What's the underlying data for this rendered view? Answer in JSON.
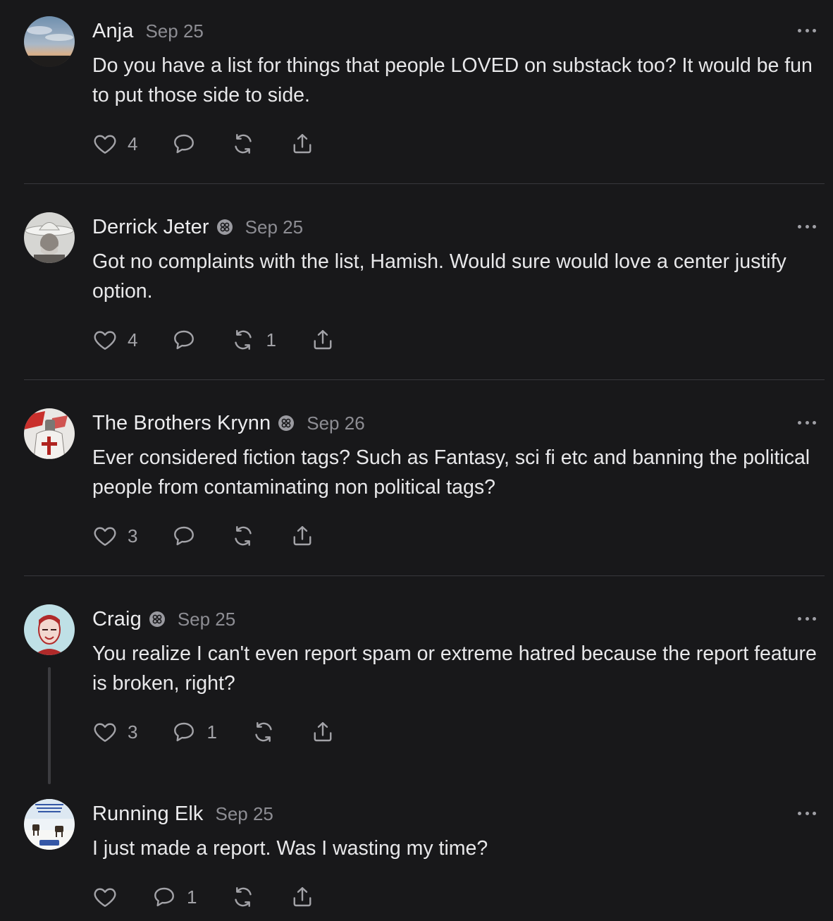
{
  "comments": [
    {
      "author": "Anja",
      "date": "Sep 25",
      "body": "Do you have a list for things that people LOVED on substack too? It would be fun to put those side to side.",
      "likes": "4",
      "replies": "",
      "restacks": "",
      "badge": false,
      "avatar": "sky-sunset-avatar"
    },
    {
      "author": "Derrick Jeter",
      "date": "Sep 25",
      "body": "Got no complaints with the list, Hamish. Would sure would love a center justify option.",
      "likes": "4",
      "replies": "",
      "restacks": "1",
      "badge": true,
      "avatar": "cowboy-hat-avatar"
    },
    {
      "author": "The Brothers Krynn",
      "date": "Sep 26",
      "body": "Ever considered fiction tags? Such as Fantasy, sci fi etc and banning the political people from contaminating non political tags?",
      "likes": "3",
      "replies": "",
      "restacks": "",
      "badge": true,
      "avatar": "knight-avatar"
    },
    {
      "author": "Craig",
      "date": "Sep 25",
      "body": "You realize I can't even report spam or extreme hatred because the report feature is broken, right?",
      "likes": "3",
      "replies": "1",
      "restacks": "",
      "badge": true,
      "avatar": "portrait-sketch-avatar"
    },
    {
      "author": "Running Elk",
      "date": "Sep 25",
      "body": "I just made a report. Was I wasting my time?",
      "likes": "",
      "replies": "1",
      "restacks": "",
      "badge": false,
      "avatar": "elk-poster-avatar"
    }
  ],
  "icons": {
    "like": "heart-icon",
    "reply": "comment-bubble-icon",
    "restack": "restack-icon",
    "share": "share-icon",
    "more": "more-options-icon",
    "badge": "subscriber-badge-icon"
  },
  "colors": {
    "background": "#18181a",
    "text": "#e8e8ea",
    "muted": "#8d8d93",
    "divider": "#38383c"
  }
}
